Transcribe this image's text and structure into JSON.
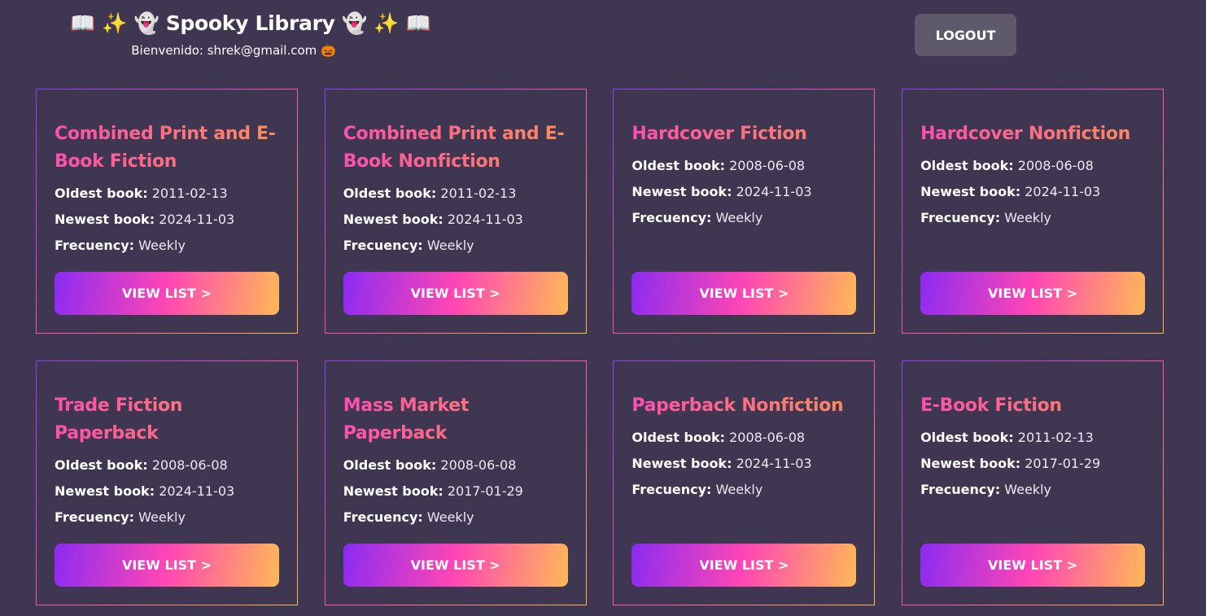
{
  "header": {
    "title": "📖 ✨ 👻 Spooky Library 👻 ✨ 📖",
    "welcome": "Bienvenido: shrek@gmail.com 🎃",
    "logout_label": "LOGOUT"
  },
  "labels": {
    "oldest": "Oldest book:",
    "newest": "Newest book:",
    "frequency": "Frecuency:",
    "view": "VIEW LIST >"
  },
  "lists": [
    {
      "name": "Combined Print and E-Book Fiction",
      "oldest": "2011-02-13",
      "newest": "2024-11-03",
      "frequency": "Weekly"
    },
    {
      "name": "Combined Print and E-Book Nonfiction",
      "oldest": "2011-02-13",
      "newest": "2024-11-03",
      "frequency": "Weekly"
    },
    {
      "name": "Hardcover Fiction",
      "oldest": "2008-06-08",
      "newest": "2024-11-03",
      "frequency": "Weekly"
    },
    {
      "name": "Hardcover Nonfiction",
      "oldest": "2008-06-08",
      "newest": "2024-11-03",
      "frequency": "Weekly"
    },
    {
      "name": "Trade Fiction Paperback",
      "oldest": "2008-06-08",
      "newest": "2024-11-03",
      "frequency": "Weekly"
    },
    {
      "name": "Mass Market Paperback",
      "oldest": "2008-06-08",
      "newest": "2017-01-29",
      "frequency": "Weekly"
    },
    {
      "name": "Paperback Nonfiction",
      "oldest": "2008-06-08",
      "newest": "2024-11-03",
      "frequency": "Weekly"
    },
    {
      "name": "E-Book Fiction",
      "oldest": "2011-02-13",
      "newest": "2017-01-29",
      "frequency": "Weekly"
    }
  ],
  "colors": {
    "background": "#3f3651",
    "logout_bg": "#5f5a6b",
    "gradient_start": "#8b2bf2",
    "gradient_mid": "#ff46b4",
    "gradient_end": "#ffb957"
  }
}
